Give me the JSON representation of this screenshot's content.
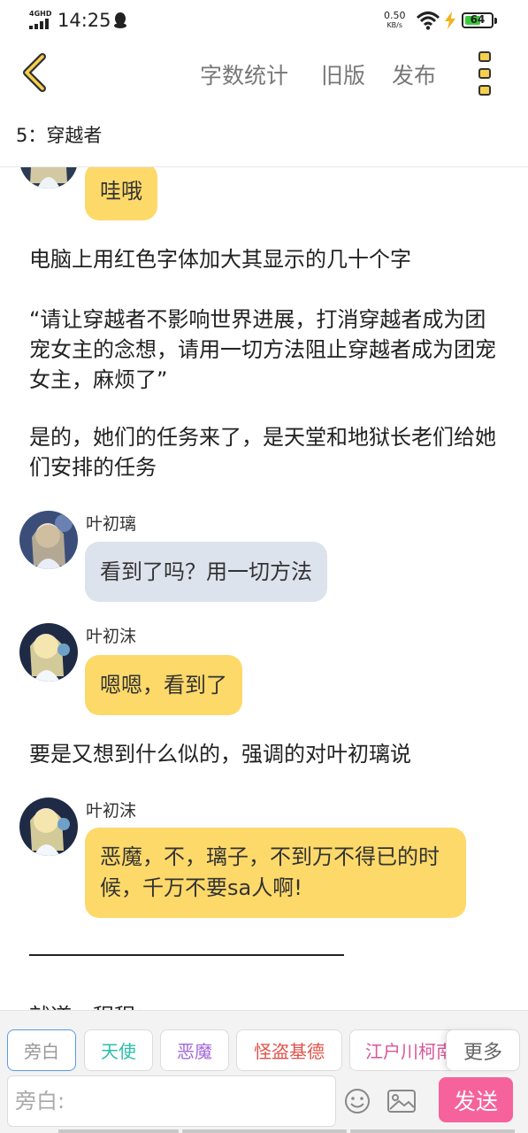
{
  "status_bar": {
    "network": "4GHD",
    "time": "14:25",
    "speed_value": "0.50",
    "speed_unit": "KB/s",
    "battery": "64"
  },
  "top_bar": {
    "actions": [
      "字数统计",
      "旧版",
      "发布"
    ]
  },
  "chapter": {
    "title": "5：穿越者"
  },
  "messages": {
    "m1": {
      "text": "哇哦"
    },
    "n1": {
      "text": "电脑上用红色字体加大其显示的几十个字"
    },
    "n2": {
      "text": "“请让穿越者不影响世界进展，打消穿越者成为团宠女主的念想，请用一切方法阻止穿越者成为团宠女主，麻烦了”"
    },
    "n3": {
      "text": "是的，她们的任务来了，是天堂和地狱长老们给她们安排的任务"
    },
    "m2": {
      "speaker": "叶初璃",
      "text": "看到了吗？用一切方法"
    },
    "m3": {
      "speaker": "叶初沫",
      "text": "嗯嗯，看到了"
    },
    "n4": {
      "text": "要是又想到什么似的，强调的对叶初璃说"
    },
    "m4": {
      "speaker": "叶初沫",
      "text": "恶魔，不，璃子，不到万不得已的时候，千万不要sa人啊!"
    },
    "n5": {
      "text": "就道，程程："
    }
  },
  "roles": [
    {
      "label": "旁白",
      "color": "#999999"
    },
    {
      "label": "天使",
      "color": "#2bbfa8"
    },
    {
      "label": "恶魔",
      "color": "#a16ad8"
    },
    {
      "label": "怪盗基德",
      "color": "#e0534a"
    },
    {
      "label": "江户川柯南",
      "color": "#d8559a"
    }
  ],
  "more_label": "更多",
  "input": {
    "placeholder": "旁白:"
  },
  "send_label": "发送"
}
